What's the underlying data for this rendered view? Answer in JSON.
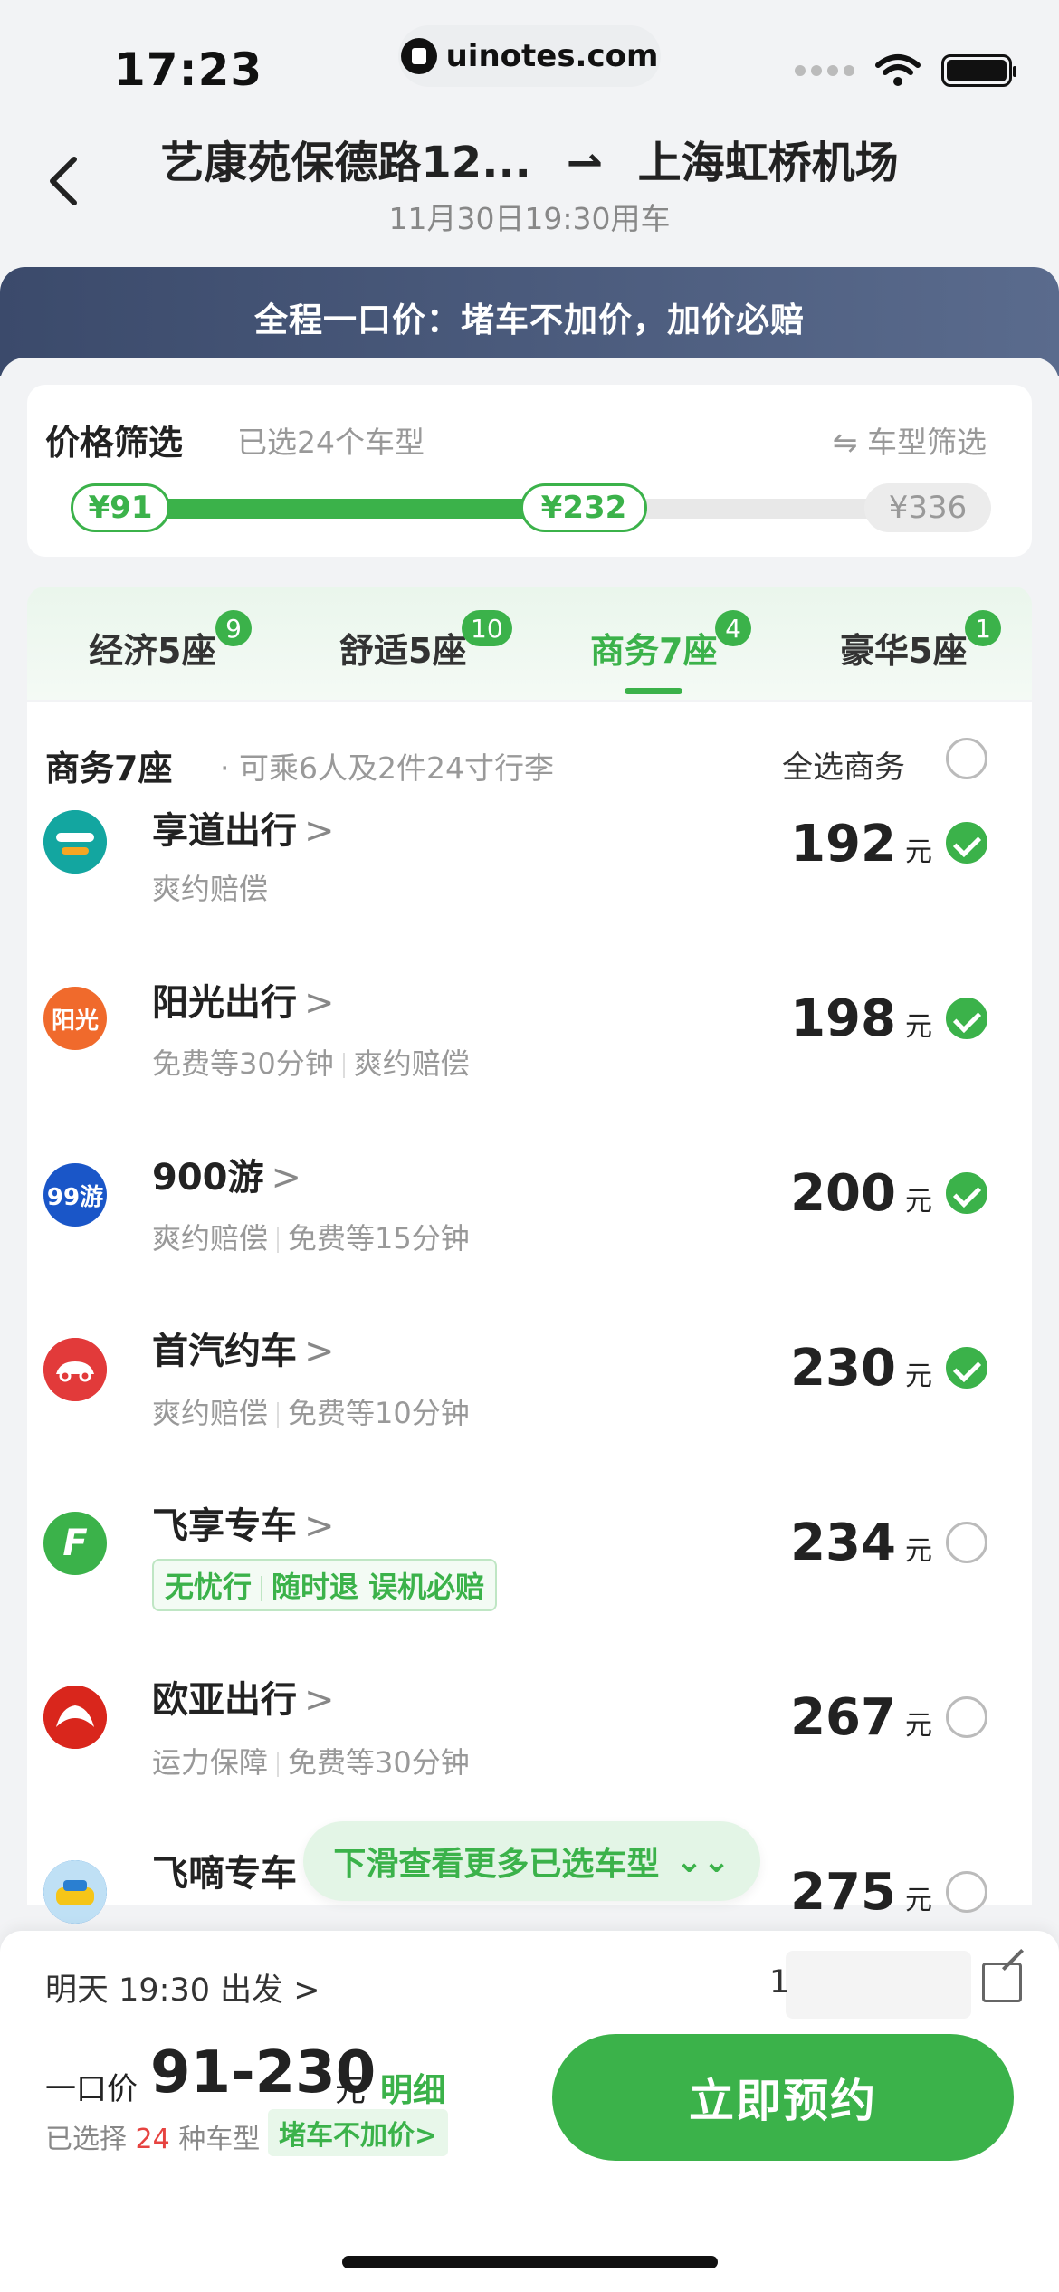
{
  "status_bar": {
    "time": "17:23",
    "url": "uinotes.com"
  },
  "header": {
    "from": "艺康苑保德路12...",
    "arrow": "⇀",
    "to": "上海虹桥机场",
    "date": "11月30日19:30用车"
  },
  "banner": {
    "text": "全程一口价：堵车不加价，加价必赔"
  },
  "price_filter": {
    "title": "价格筛选",
    "subtitle": "已选24个车型",
    "right_label": "⇋ 车型筛选",
    "min": "¥91",
    "mid": "¥232",
    "max": "¥336"
  },
  "tabs": [
    {
      "label": "经济5座",
      "badge": "9"
    },
    {
      "label": "舒适5座",
      "badge": "10"
    },
    {
      "label": "商务7座",
      "badge": "4"
    },
    {
      "label": "豪华5座",
      "badge": "1"
    }
  ],
  "list_header": {
    "title": "商务7座",
    "subtitle": "· 可乘6人及2件24寸行李",
    "select_all": "全选商务"
  },
  "providers": [
    {
      "name": "享道出行",
      "chev": ">",
      "tags": [
        "爽约赔偿"
      ],
      "price": "192",
      "unit": "元",
      "checked": true,
      "logo_color": "#1aa3a3",
      "logo_text": ""
    },
    {
      "name": "阳光出行",
      "chev": ">",
      "tags": [
        "免费等30分钟",
        "爽约赔偿"
      ],
      "price": "198",
      "unit": "元",
      "checked": true,
      "logo_color": "#f06a2c",
      "logo_text": "阳光"
    },
    {
      "name": "900游",
      "chev": ">",
      "tags": [
        "爽约赔偿",
        "免费等15分钟"
      ],
      "price": "200",
      "unit": "元",
      "checked": true,
      "logo_color": "#1a56c8",
      "logo_text": "99游"
    },
    {
      "name": "首汽约车",
      "chev": ">",
      "tags": [
        "爽约赔偿",
        "免费等10分钟"
      ],
      "price": "230",
      "unit": "元",
      "checked": true,
      "logo_color": "#e63b3b",
      "logo_text": ""
    },
    {
      "name": "飞享专车",
      "chev": ">",
      "tags": [
        "无忧行",
        "随时退 误机必赔"
      ],
      "price": "234",
      "unit": "元",
      "checked": false,
      "logo_color": "#3bb24a",
      "logo_text": "F",
      "green_tags": true
    },
    {
      "name": "欧亚出行",
      "chev": ">",
      "tags": [
        "运力保障",
        "免费等30分钟"
      ],
      "price": "267",
      "unit": "元",
      "checked": false,
      "logo_color": "#d9261c",
      "logo_text": ""
    },
    {
      "name": "飞嘀专车",
      "chev": "",
      "tags": [],
      "price": "275",
      "unit": "元",
      "checked": false,
      "logo_color": "#2a7fd1",
      "logo_text": ""
    }
  ],
  "scroll_hint": {
    "text": "下滑查看更多已选车型",
    "icon": "⌄⌄"
  },
  "bottom": {
    "depart": "明天 19:30 出发",
    "depart_chev": ">",
    "passenger": "1",
    "price_label": "一口价",
    "price_range": "91-230",
    "price_unit": "元",
    "detail": "明细",
    "chosen_prefix": "已选择",
    "chosen_count": "24",
    "chosen_suffix": "种车型",
    "chosen_badge": "堵车不加价>",
    "book_button": "立即预约"
  },
  "colors": {
    "accent": "#3bb24a",
    "banner": "#4b5b7d"
  }
}
